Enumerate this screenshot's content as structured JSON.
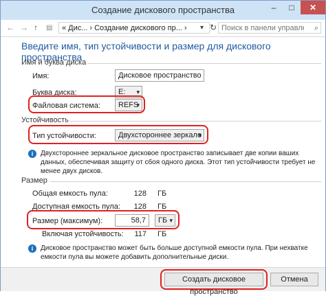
{
  "window": {
    "title": "Создание дискового пространства",
    "min": "–",
    "max": "□",
    "close": "✕"
  },
  "nav": {
    "back": "←",
    "forward": "→",
    "up": "↑",
    "crumbs": [
      "«",
      "Дис...",
      "›",
      "Создание дискового пр...",
      "›"
    ],
    "crumb_dropdown": "▾",
    "refresh": "↻",
    "search_placeholder": "Поиск в панели управления"
  },
  "heading": "Введите имя, тип устойчивости и размер для дискового пространства",
  "name_section": {
    "title": "Имя и буква диска",
    "name_label": "Имя:",
    "name_value": "Дисковое пространство",
    "letter_label": "Буква диска:",
    "letter_value": "E:",
    "fs_label": "Файловая система:",
    "fs_value": "REFS"
  },
  "resiliency_section": {
    "title": "Устойчивость",
    "type_label": "Тип устойчивости:",
    "type_value": "Двухстороннее зеркало",
    "info": "Двухстороннее зеркальное дисковое пространство записывает две копии ваших данных, обеспечивая защиту от сбоя одного диска. Этот тип устойчивости требует не менее двух дисков."
  },
  "size_section": {
    "title": "Размер",
    "total_label": "Общая емкость пула:",
    "total_value": "128",
    "total_unit": "ГБ",
    "available_label": "Доступная емкость пула:",
    "available_value": "128",
    "available_unit": "ГБ",
    "size_label": "Размер (максимум):",
    "size_value": "58,7",
    "size_unit": "ГБ",
    "resilient_label": "Включая устойчивость:",
    "resilient_value": "117",
    "resilient_unit": "ГБ",
    "info": "Дисковое пространство может быть больше доступной емкости пула. При нехватке емкости пула вы можете добавить дополнительные диски."
  },
  "buttons": {
    "create": "Создать дисковое пространство",
    "cancel": "Отмена"
  },
  "info_icon": "i",
  "arrow": "▾",
  "colors": {
    "accent": "#1e5a9e",
    "highlight": "#e02020",
    "info": "#1f6fbf"
  }
}
